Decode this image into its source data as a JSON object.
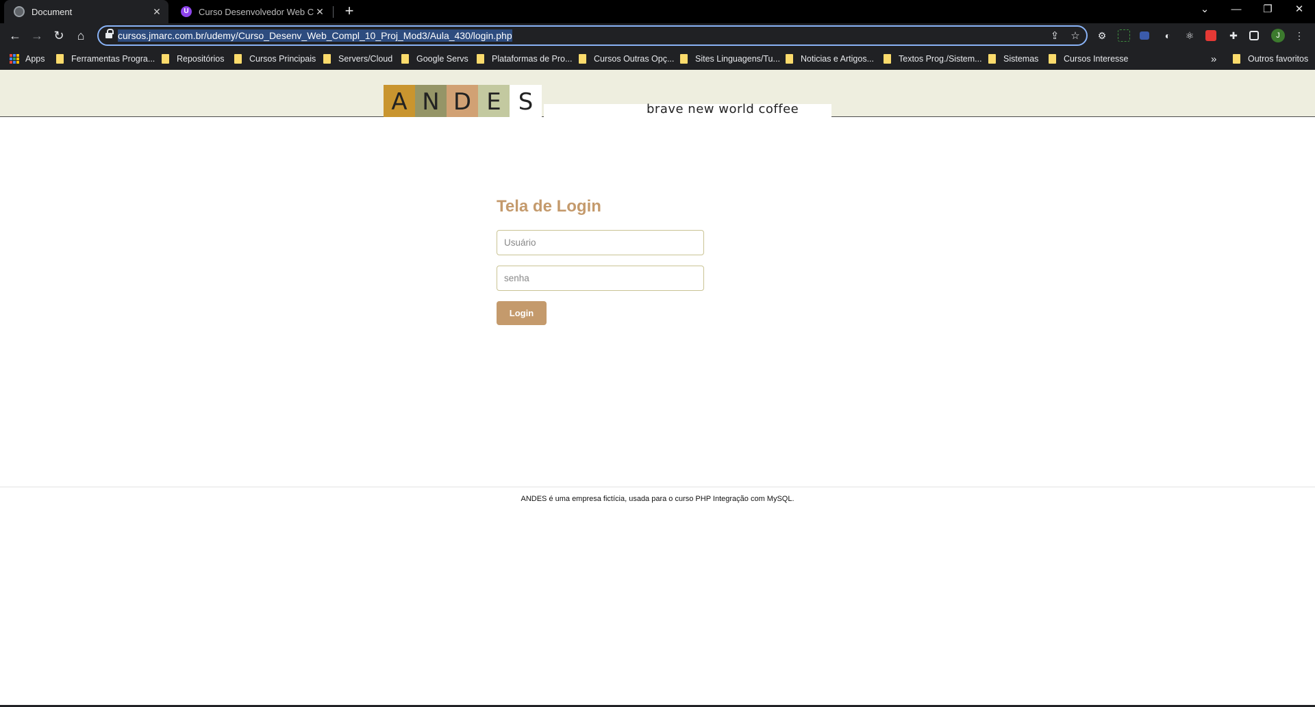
{
  "browser": {
    "tabs": [
      {
        "title": "Document",
        "active": true
      },
      {
        "title": "Curso Desenvolvedor Web Comp",
        "active": false
      }
    ],
    "new_tab_symbol": "+",
    "close_symbol": "✕",
    "window_controls": [
      "⌄",
      "—",
      "❐",
      "✕"
    ],
    "url": "cursos.jmarc.com.br/udemy/Curso_Desenv_Web_Compl_10_Proj_Mod3/Aula_430/login.php",
    "profile_initial": "J",
    "bookmarks": [
      {
        "label": "Apps",
        "type": "apps"
      },
      {
        "label": "Ferramentas Progra...",
        "type": "folder"
      },
      {
        "label": "Repositórios",
        "type": "folder"
      },
      {
        "label": "Cursos Principais",
        "type": "folder"
      },
      {
        "label": "Servers/Cloud",
        "type": "folder"
      },
      {
        "label": "Google Servs",
        "type": "folder"
      },
      {
        "label": "Plataformas de Pro...",
        "type": "folder"
      },
      {
        "label": "Cursos Outras Opç...",
        "type": "folder"
      },
      {
        "label": "Sites Linguagens/Tu...",
        "type": "folder"
      },
      {
        "label": "Noticias e Artigos...",
        "type": "folder"
      },
      {
        "label": "Textos Prog./Sistem...",
        "type": "folder"
      },
      {
        "label": "Sistemas",
        "type": "folder"
      },
      {
        "label": "Cursos Interesse",
        "type": "folder"
      }
    ],
    "bookmarks_overflow": "»",
    "other_bookmarks": "Outros favoritos"
  },
  "site": {
    "logo_letters": [
      "A",
      "N",
      "D",
      "E",
      "S"
    ],
    "tagline": "brave new world coffee",
    "colors": {
      "header_bg": "#eeeedf",
      "accent": "#c49a6c",
      "input_border": "#c9c393"
    }
  },
  "login": {
    "title": "Tela de Login",
    "username_placeholder": "Usuário",
    "password_placeholder": "senha",
    "submit_label": "Login"
  },
  "footer": {
    "text": "ANDES é uma empresa fictícia, usada para o curso PHP Integração com MySQL."
  }
}
